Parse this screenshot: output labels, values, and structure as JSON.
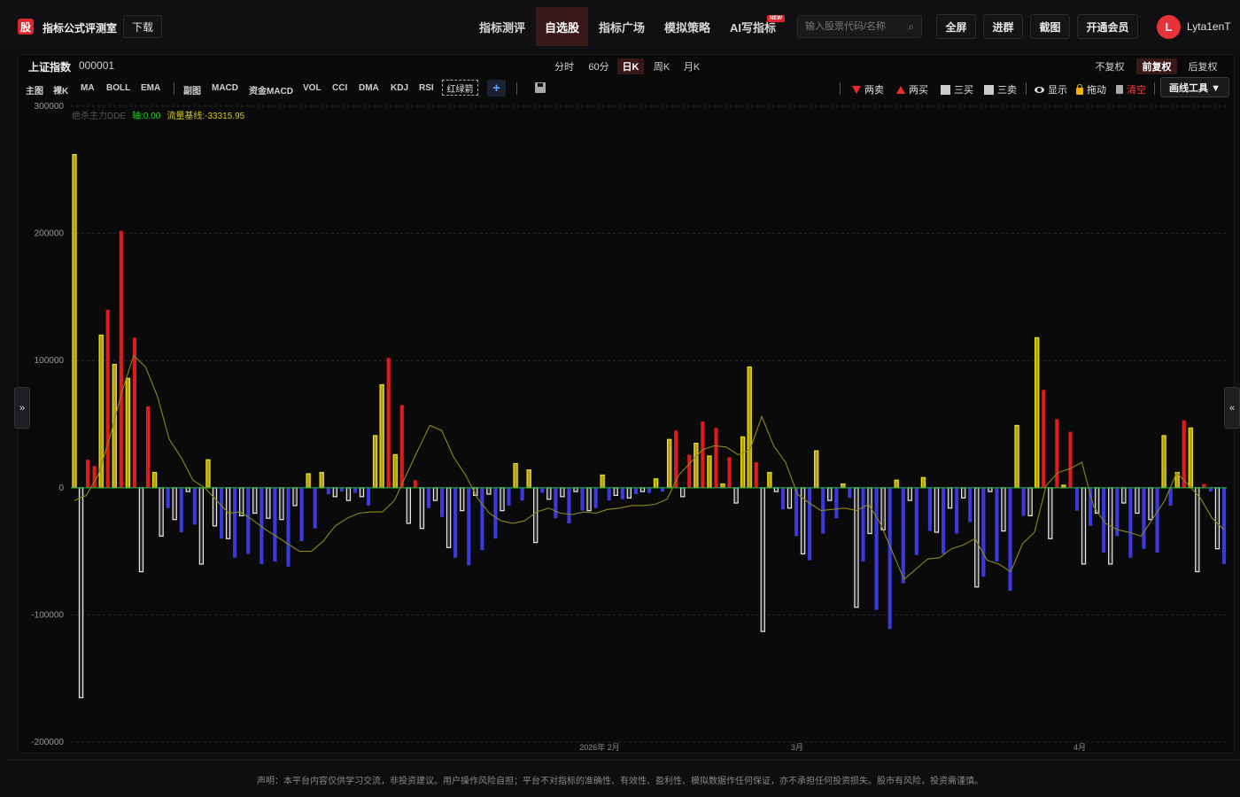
{
  "header": {
    "logo": "股",
    "title": "指标公式评测室",
    "download": "下载",
    "nav": [
      {
        "label": "指标测评",
        "active": false
      },
      {
        "label": "自选股",
        "active": true
      },
      {
        "label": "指标广场",
        "active": false
      },
      {
        "label": "模拟策略",
        "active": false
      },
      {
        "label": "AI写指标",
        "active": false
      }
    ],
    "new_badge": "NEW",
    "search_placeholder": "输入股票代码/名称",
    "search_icon": "⌕",
    "buttons": [
      "全屏",
      "进群",
      "截图",
      "开通会员"
    ],
    "avatar": "L",
    "username": "Lyta1enT"
  },
  "toolbar": {
    "stock_name": "上证指数",
    "stock_code": "000001",
    "periods": [
      {
        "label": "分时",
        "active": false
      },
      {
        "label": "60分",
        "active": false
      },
      {
        "label": "日K",
        "active": true
      },
      {
        "label": "周K",
        "active": false
      },
      {
        "label": "月K",
        "active": false
      }
    ],
    "adjust": [
      {
        "label": "不复权",
        "active": false
      },
      {
        "label": "前复权",
        "active": true
      },
      {
        "label": "后复权",
        "active": false
      }
    ],
    "indicators_main": [
      "主图",
      "裸K",
      "MA",
      "BOLL",
      "EMA"
    ],
    "indicators_sub": [
      "副图",
      "MACD",
      "资金MACD",
      "VOL",
      "CCI",
      "DMA",
      "KDJ",
      "RSI"
    ],
    "redgreen": "红绿箭",
    "plus": "+",
    "tools": {
      "two_sell": "两卖",
      "two_buy": "两买",
      "three_buy": "三买",
      "three_sell": "三卖",
      "show": "显示",
      "drag": "拖动",
      "clear": "清空"
    },
    "draw_tools": "画线工具 ▼"
  },
  "side_tabs": {
    "left": "»",
    "right": "«"
  },
  "disclaimer": "声明：本平台内容仅供学习交流，非投资建议。用户操作风险自担；平台不对指标的准确性、有效性、盈利性、模拟数据作任何保证，亦不承担任何投资损失。股市有风险，投资需谨慎。",
  "colors": {
    "yellow": "#e6e61a",
    "red": "#e01b1b",
    "white": "#e8e8e8",
    "blue": "#3a3adc",
    "zero_line": "#1fb03c",
    "ma_line": "#8a8a1a"
  },
  "chart_data": {
    "type": "bar",
    "indicator_name": "绝杀主力DDE",
    "legend": [
      {
        "label": "轴:0.00",
        "color": "#2ad82a"
      },
      {
        "label": "流量基线:-33315.95",
        "color": "#d8c81a"
      }
    ],
    "y_ticks": [
      300000,
      200000,
      100000,
      0,
      -100000,
      -200000
    ],
    "y_tick_labels": [
      "300000",
      "200000",
      "100000",
      "0",
      "-100000",
      "-200000"
    ],
    "ylim": [
      -200000,
      300000
    ],
    "x_labels": [
      "2026年 2月",
      "3月",
      "4月"
    ],
    "series": {
      "yellow": [
        262000,
        0,
        4000,
        120000,
        97000,
        86000,
        0,
        12000,
        0,
        0,
        0,
        0,
        0,
        0,
        22000,
        0,
        0,
        0,
        0,
        0,
        0,
        0,
        0,
        0,
        0,
        0,
        11000,
        0,
        12000,
        0,
        0,
        0,
        0,
        0,
        0,
        41000,
        81000,
        26000,
        0,
        0,
        0,
        0,
        0,
        0,
        0,
        0,
        0,
        0,
        0,
        0,
        0,
        0,
        0,
        0,
        0,
        0,
        0,
        0,
        0,
        0,
        10000,
        0,
        0,
        0,
        0,
        0,
        0,
        0,
        0,
        0,
        0,
        0,
        0,
        0,
        0,
        0,
        0,
        0,
        0,
        0,
        0,
        0,
        0,
        0,
        0,
        0,
        0,
        0,
        0,
        0,
        0,
        0,
        0,
        0,
        0,
        0,
        0,
        0,
        0,
        0,
        0,
        0,
        0,
        0,
        0,
        0,
        0,
        0,
        0,
        0,
        0,
        0,
        0,
        0,
        0,
        0,
        0,
        0,
        0,
        0,
        0,
        0,
        0,
        0,
        0,
        0,
        0,
        0
      ],
      "red": [
        0,
        22000,
        17000,
        0,
        140000,
        202000,
        118000,
        64000,
        0,
        0,
        0,
        0,
        0,
        0,
        0,
        0,
        0,
        0,
        0,
        0,
        0,
        0,
        0,
        0,
        0,
        0,
        0,
        0,
        0,
        0,
        0,
        0,
        0,
        0,
        0,
        0,
        0,
        102000,
        65000,
        6000,
        0,
        0,
        0,
        0,
        0,
        0,
        0,
        0,
        0,
        0,
        0,
        0,
        0,
        0,
        0,
        0,
        0,
        0,
        0,
        0,
        0,
        0,
        0,
        0,
        0,
        0,
        0,
        0,
        0,
        0,
        0,
        0,
        0,
        0,
        0,
        0,
        0,
        0,
        0,
        0,
        0,
        0,
        0,
        0,
        0,
        0,
        0,
        0,
        0,
        0,
        0,
        0,
        0,
        0,
        0,
        0,
        0,
        0,
        0,
        0,
        0,
        0,
        0,
        0,
        0,
        0,
        0,
        0,
        0,
        0,
        0,
        0,
        0,
        0,
        0,
        0,
        0,
        0,
        0,
        0,
        0,
        0,
        0,
        0,
        0,
        0,
        0,
        0,
        0,
        0
      ]
    },
    "bars": [
      {
        "c": "yellow",
        "v": 262000
      },
      {
        "c": "white",
        "v": -165000
      },
      {
        "c": "red",
        "v": 22000
      },
      {
        "c": "red",
        "v": 17000
      },
      {
        "c": "yellow",
        "v": 120000
      },
      {
        "c": "red",
        "v": 140000
      },
      {
        "c": "yellow",
        "v": 97000
      },
      {
        "c": "red",
        "v": 202000
      },
      {
        "c": "yellow",
        "v": 86000
      },
      {
        "c": "red",
        "v": 118000
      },
      {
        "c": "white",
        "v": -66000
      },
      {
        "c": "red",
        "v": 64000
      },
      {
        "c": "yellow",
        "v": 12000
      },
      {
        "c": "white",
        "v": -38000
      },
      {
        "c": "blue",
        "v": -16000
      },
      {
        "c": "white",
        "v": -25000
      },
      {
        "c": "blue",
        "v": -35000
      },
      {
        "c": "white",
        "v": -3000
      },
      {
        "c": "blue",
        "v": -29000
      },
      {
        "c": "white",
        "v": -60000
      },
      {
        "c": "yellow",
        "v": 22000
      },
      {
        "c": "white",
        "v": -30000
      },
      {
        "c": "blue",
        "v": -40000
      },
      {
        "c": "white",
        "v": -40000
      },
      {
        "c": "blue",
        "v": -55000
      },
      {
        "c": "white",
        "v": -22000
      },
      {
        "c": "blue",
        "v": -52000
      },
      {
        "c": "white",
        "v": -20000
      },
      {
        "c": "blue",
        "v": -60000
      },
      {
        "c": "white",
        "v": -24000
      },
      {
        "c": "blue",
        "v": -58000
      },
      {
        "c": "white",
        "v": -25000
      },
      {
        "c": "blue",
        "v": -62000
      },
      {
        "c": "white",
        "v": -14000
      },
      {
        "c": "blue",
        "v": -42000
      },
      {
        "c": "yellow",
        "v": 11000
      },
      {
        "c": "blue",
        "v": -32000
      },
      {
        "c": "yellow",
        "v": 12000
      },
      {
        "c": "blue",
        "v": -5000
      },
      {
        "c": "white",
        "v": -7000
      },
      {
        "c": "blue",
        "v": -3000
      },
      {
        "c": "white",
        "v": -10000
      },
      {
        "c": "blue",
        "v": -4000
      },
      {
        "c": "white",
        "v": -7000
      },
      {
        "c": "blue",
        "v": -14000
      },
      {
        "c": "yellow",
        "v": 41000
      },
      {
        "c": "yellow",
        "v": 81000
      },
      {
        "c": "red",
        "v": 102000
      },
      {
        "c": "yellow",
        "v": 26000
      },
      {
        "c": "red",
        "v": 65000
      },
      {
        "c": "white",
        "v": -28000
      },
      {
        "c": "red",
        "v": 6000
      },
      {
        "c": "white",
        "v": -32000
      },
      {
        "c": "blue",
        "v": -16000
      },
      {
        "c": "white",
        "v": -10000
      },
      {
        "c": "blue",
        "v": -23000
      },
      {
        "c": "white",
        "v": -47000
      },
      {
        "c": "blue",
        "v": -55000
      },
      {
        "c": "white",
        "v": -18000
      },
      {
        "c": "blue",
        "v": -61000
      },
      {
        "c": "white",
        "v": -6000
      },
      {
        "c": "blue",
        "v": -49000
      },
      {
        "c": "white",
        "v": -5000
      },
      {
        "c": "blue",
        "v": -40000
      },
      {
        "c": "white",
        "v": -18000
      },
      {
        "c": "blue",
        "v": -14000
      },
      {
        "c": "yellow",
        "v": 19000
      },
      {
        "c": "blue",
        "v": -10000
      },
      {
        "c": "yellow",
        "v": 14000
      },
      {
        "c": "white",
        "v": -43000
      },
      {
        "c": "blue",
        "v": -4000
      },
      {
        "c": "white",
        "v": -9000
      },
      {
        "c": "blue",
        "v": -24000
      },
      {
        "c": "white",
        "v": -7000
      },
      {
        "c": "blue",
        "v": -28000
      },
      {
        "c": "white",
        "v": -3000
      },
      {
        "c": "blue",
        "v": -18000
      },
      {
        "c": "white",
        "v": -18000
      },
      {
        "c": "blue",
        "v": -16000
      },
      {
        "c": "yellow",
        "v": 10000
      },
      {
        "c": "blue",
        "v": -10000
      },
      {
        "c": "white",
        "v": -6000
      },
      {
        "c": "blue",
        "v": -9000
      },
      {
        "c": "white",
        "v": -8000
      },
      {
        "c": "blue",
        "v": -5000
      },
      {
        "c": "white",
        "v": -3000
      },
      {
        "c": "blue",
        "v": -4000
      },
      {
        "c": "yellow",
        "v": 7000
      },
      {
        "c": "blue",
        "v": -3000
      },
      {
        "c": "yellow",
        "v": 38000
      },
      {
        "c": "red",
        "v": 45000
      },
      {
        "c": "white",
        "v": -7000
      },
      {
        "c": "red",
        "v": 26000
      },
      {
        "c": "yellow",
        "v": 35000
      },
      {
        "c": "red",
        "v": 52000
      },
      {
        "c": "yellow",
        "v": 25000
      },
      {
        "c": "red",
        "v": 47000
      },
      {
        "c": "yellow",
        "v": 3000
      },
      {
        "c": "red",
        "v": 24000
      },
      {
        "c": "white",
        "v": -12000
      },
      {
        "c": "yellow",
        "v": 40000
      },
      {
        "c": "yellow",
        "v": 95000
      },
      {
        "c": "red",
        "v": 20000
      },
      {
        "c": "white",
        "v": -113000
      },
      {
        "c": "yellow",
        "v": 12000
      },
      {
        "c": "white",
        "v": -3000
      },
      {
        "c": "blue",
        "v": -17000
      },
      {
        "c": "white",
        "v": -16000
      },
      {
        "c": "blue",
        "v": -38000
      },
      {
        "c": "white",
        "v": -52000
      },
      {
        "c": "blue",
        "v": -57000
      },
      {
        "c": "yellow",
        "v": 29000
      },
      {
        "c": "blue",
        "v": -36000
      },
      {
        "c": "white",
        "v": -10000
      },
      {
        "c": "blue",
        "v": -24000
      },
      {
        "c": "yellow",
        "v": 3000
      },
      {
        "c": "blue",
        "v": -8000
      },
      {
        "c": "white",
        "v": -94000
      },
      {
        "c": "blue",
        "v": -58000
      },
      {
        "c": "white",
        "v": -36000
      },
      {
        "c": "blue",
        "v": -96000
      },
      {
        "c": "white",
        "v": -33000
      },
      {
        "c": "blue",
        "v": -111000
      },
      {
        "c": "yellow",
        "v": 6000
      },
      {
        "c": "blue",
        "v": -75000
      },
      {
        "c": "white",
        "v": -10000
      },
      {
        "c": "blue",
        "v": -53000
      },
      {
        "c": "yellow",
        "v": 8000
      },
      {
        "c": "blue",
        "v": -34000
      },
      {
        "c": "white",
        "v": -35000
      },
      {
        "c": "blue",
        "v": -52000
      },
      {
        "c": "white",
        "v": -16000
      },
      {
        "c": "blue",
        "v": -36000
      },
      {
        "c": "white",
        "v": -8000
      },
      {
        "c": "blue",
        "v": -27000
      },
      {
        "c": "white",
        "v": -78000
      },
      {
        "c": "blue",
        "v": -70000
      },
      {
        "c": "white",
        "v": -3000
      },
      {
        "c": "blue",
        "v": -58000
      },
      {
        "c": "white",
        "v": -34000
      },
      {
        "c": "blue",
        "v": -81000
      },
      {
        "c": "yellow",
        "v": 49000
      },
      {
        "c": "blue",
        "v": -22000
      },
      {
        "c": "white",
        "v": -22000
      },
      {
        "c": "yellow",
        "v": 118000
      },
      {
        "c": "red",
        "v": 77000
      },
      {
        "c": "white",
        "v": -40000
      },
      {
        "c": "red",
        "v": 54000
      },
      {
        "c": "yellow",
        "v": 2000
      },
      {
        "c": "red",
        "v": 44000
      },
      {
        "c": "blue",
        "v": -18000
      },
      {
        "c": "white",
        "v": -60000
      },
      {
        "c": "blue",
        "v": -30000
      },
      {
        "c": "white",
        "v": -20000
      },
      {
        "c": "blue",
        "v": -51000
      },
      {
        "c": "white",
        "v": -60000
      },
      {
        "c": "blue",
        "v": -38000
      },
      {
        "c": "white",
        "v": -12000
      },
      {
        "c": "blue",
        "v": -55000
      },
      {
        "c": "white",
        "v": -20000
      },
      {
        "c": "blue",
        "v": -48000
      },
      {
        "c": "white",
        "v": -25000
      },
      {
        "c": "blue",
        "v": -51000
      },
      {
        "c": "yellow",
        "v": 41000
      },
      {
        "c": "blue",
        "v": -14000
      },
      {
        "c": "yellow",
        "v": 12000
      },
      {
        "c": "red",
        "v": 53000
      },
      {
        "c": "yellow",
        "v": 47000
      },
      {
        "c": "white",
        "v": -66000
      },
      {
        "c": "red",
        "v": 3000
      },
      {
        "c": "blue",
        "v": -3000
      },
      {
        "c": "white",
        "v": -48000
      },
      {
        "c": "blue",
        "v": -60000
      }
    ],
    "ma_line": [
      -10000,
      -6000,
      10000,
      40000,
      75000,
      104000,
      95000,
      72000,
      38000,
      24000,
      6000,
      0,
      -10000,
      -20000,
      -19000,
      -25000,
      -32000,
      -38000,
      -44000,
      -50000,
      -50000,
      -42000,
      -30000,
      -24000,
      -20000,
      -19000,
      -19000,
      -10000,
      10000,
      30000,
      49000,
      45000,
      24000,
      10000,
      -8000,
      -20000,
      -26000,
      -28000,
      -26000,
      -19000,
      -16000,
      -20000,
      -21000,
      -19000,
      -20000,
      -17000,
      -16000,
      -14000,
      -14000,
      -13000,
      -9000,
      10000,
      20000,
      30000,
      33000,
      32000,
      26000,
      30000,
      56000,
      33000,
      20000,
      -5000,
      -12000,
      -18000,
      -17000,
      -16000,
      -18000,
      -13000,
      -28000,
      -50000,
      -72000,
      -64000,
      -56000,
      -55000,
      -48000,
      -45000,
      -40000,
      -57000,
      -60000,
      -66000,
      -44000,
      -35000,
      2000,
      12000,
      15000,
      20000,
      -15000,
      -28000,
      -33000,
      -35000,
      -38000,
      -24000,
      -10000,
      12000,
      2000,
      -8000,
      -24000,
      -33000
    ]
  }
}
